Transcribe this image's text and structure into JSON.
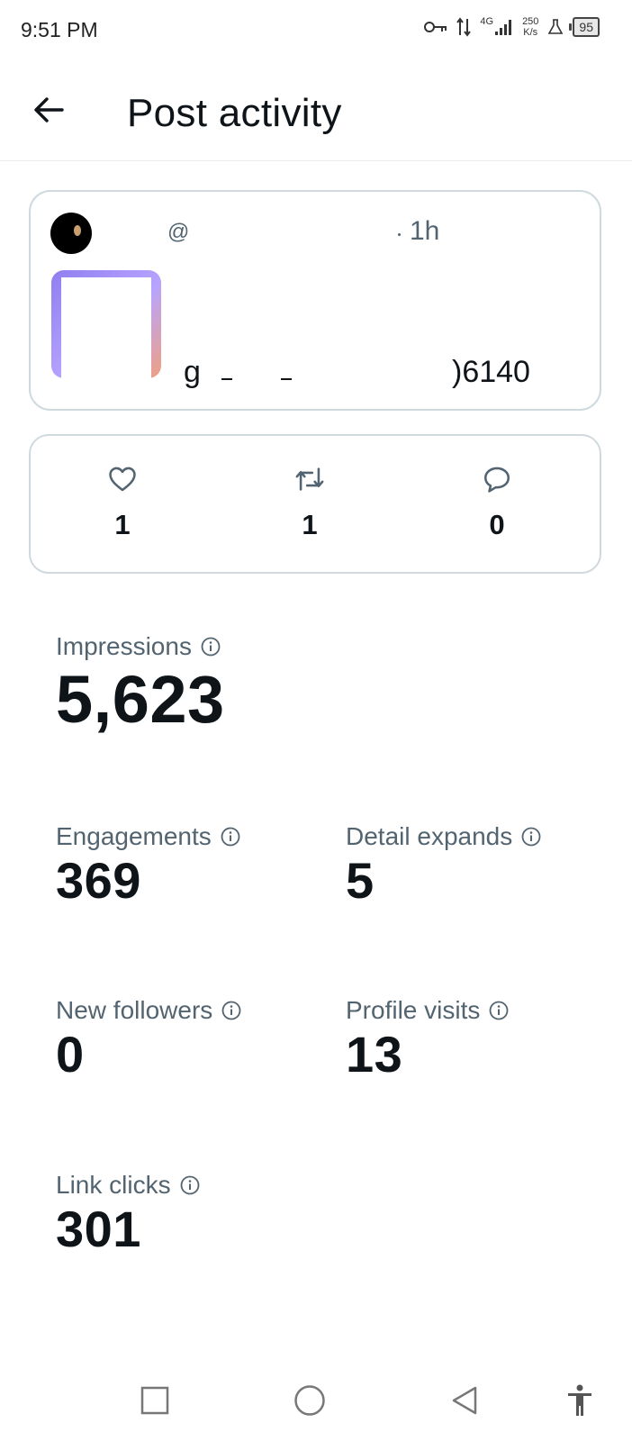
{
  "status_bar": {
    "time": "9:51 PM",
    "network": "4G",
    "speed_value": "250",
    "speed_unit": "K/s",
    "battery": "95"
  },
  "header": {
    "title": "Post activity",
    "back_icon": "arrow-left-icon"
  },
  "post": {
    "handle": "@",
    "time": "1h",
    "text_start": "g",
    "text_end": ")6140"
  },
  "engagement_counts": {
    "likes": "1",
    "reposts": "1",
    "replies": "0"
  },
  "metrics": {
    "impressions": {
      "label": "Impressions",
      "value": "5,623"
    },
    "engagements": {
      "label": "Engagements",
      "value": "369"
    },
    "detail_expands": {
      "label": "Detail expands",
      "value": "5"
    },
    "new_followers": {
      "label": "New followers",
      "value": "0"
    },
    "profile_visits": {
      "label": "Profile visits",
      "value": "13"
    },
    "link_clicks": {
      "label": "Link clicks",
      "value": "301"
    }
  },
  "colors": {
    "text_primary": "#0f1419",
    "text_secondary": "#536471",
    "border": "#cfd9de"
  }
}
